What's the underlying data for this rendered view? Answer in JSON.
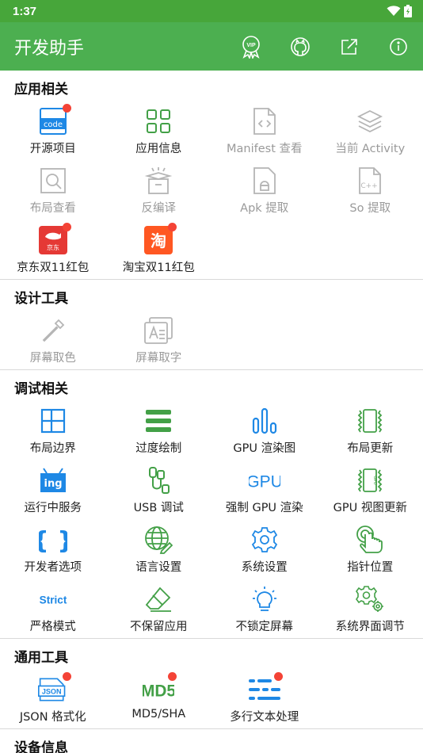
{
  "status": {
    "time": "1:37"
  },
  "appbar": {
    "title": "开发助手"
  },
  "colors": {
    "primary": "#4caf50",
    "accent": "#2196f3",
    "green_icon": "#43a047",
    "badge": "#f44336"
  },
  "sections": {
    "app": {
      "title": "应用相关",
      "items": [
        {
          "label": "开源项目",
          "icon": "code-icon",
          "badge": true
        },
        {
          "label": "应用信息",
          "icon": "grid-icon"
        },
        {
          "label": "Manifest 查看",
          "icon": "file-code-icon",
          "disabled": true
        },
        {
          "label": "当前 Activity",
          "icon": "layers-icon",
          "disabled": true
        },
        {
          "label": "布局查看",
          "icon": "layout-search-icon",
          "disabled": true
        },
        {
          "label": "反编译",
          "icon": "box-icon",
          "disabled": true
        },
        {
          "label": "Apk 提取",
          "icon": "apk-icon",
          "disabled": true
        },
        {
          "label": "So 提取",
          "icon": "cpp-file-icon",
          "disabled": true
        },
        {
          "label": "京东双11红包",
          "icon": "jd-icon",
          "badge": true,
          "icon_text": "京东"
        },
        {
          "label": "淘宝双11红包",
          "icon": "taobao-icon",
          "badge": true,
          "icon_text": "淘"
        }
      ]
    },
    "design": {
      "title": "设计工具",
      "items": [
        {
          "label": "屏幕取色",
          "icon": "eyedropper-icon",
          "disabled": true
        },
        {
          "label": "屏幕取字",
          "icon": "text-capture-icon",
          "disabled": true
        }
      ]
    },
    "debug": {
      "title": "调试相关",
      "items": [
        {
          "label": "布局边界",
          "icon": "layout-bounds-icon"
        },
        {
          "label": "过度绘制",
          "icon": "overdraw-icon"
        },
        {
          "label": "GPU 渲染图",
          "icon": "bars-icon"
        },
        {
          "label": "布局更新",
          "icon": "layout-update-icon"
        },
        {
          "label": "运行中服务",
          "icon": "running-service-icon",
          "icon_text": "ing"
        },
        {
          "label": "USB 调试",
          "icon": "usb-icon"
        },
        {
          "label": "强制 GPU 渲染",
          "icon": "gpu-icon",
          "icon_text": "GPU"
        },
        {
          "label": "GPU 视图更新",
          "icon": "gpu-view-icon",
          "icon_text": "GPU"
        },
        {
          "label": "开发者选项",
          "icon": "braces-icon",
          "icon_text": "{ }"
        },
        {
          "label": "语言设置",
          "icon": "globe-icon"
        },
        {
          "label": "系统设置",
          "icon": "gear-icon"
        },
        {
          "label": "指针位置",
          "icon": "pointer-icon"
        },
        {
          "label": "严格模式",
          "icon": "strict-icon",
          "icon_text": "Strict"
        },
        {
          "label": "不保留应用",
          "icon": "eraser-icon"
        },
        {
          "label": "不锁定屏幕",
          "icon": "bulb-icon"
        },
        {
          "label": "系统界面调节",
          "icon": "gears-icon"
        }
      ]
    },
    "tools": {
      "title": "通用工具",
      "items": [
        {
          "label": "JSON 格式化",
          "icon": "json-icon",
          "badge": true,
          "icon_text": "JSON"
        },
        {
          "label": "MD5/SHA",
          "icon": "md5-icon",
          "badge": true,
          "icon_text": "MD5"
        },
        {
          "label": "多行文本处理",
          "icon": "multiline-icon",
          "badge": true
        }
      ]
    },
    "device": {
      "title": "设备信息"
    }
  }
}
